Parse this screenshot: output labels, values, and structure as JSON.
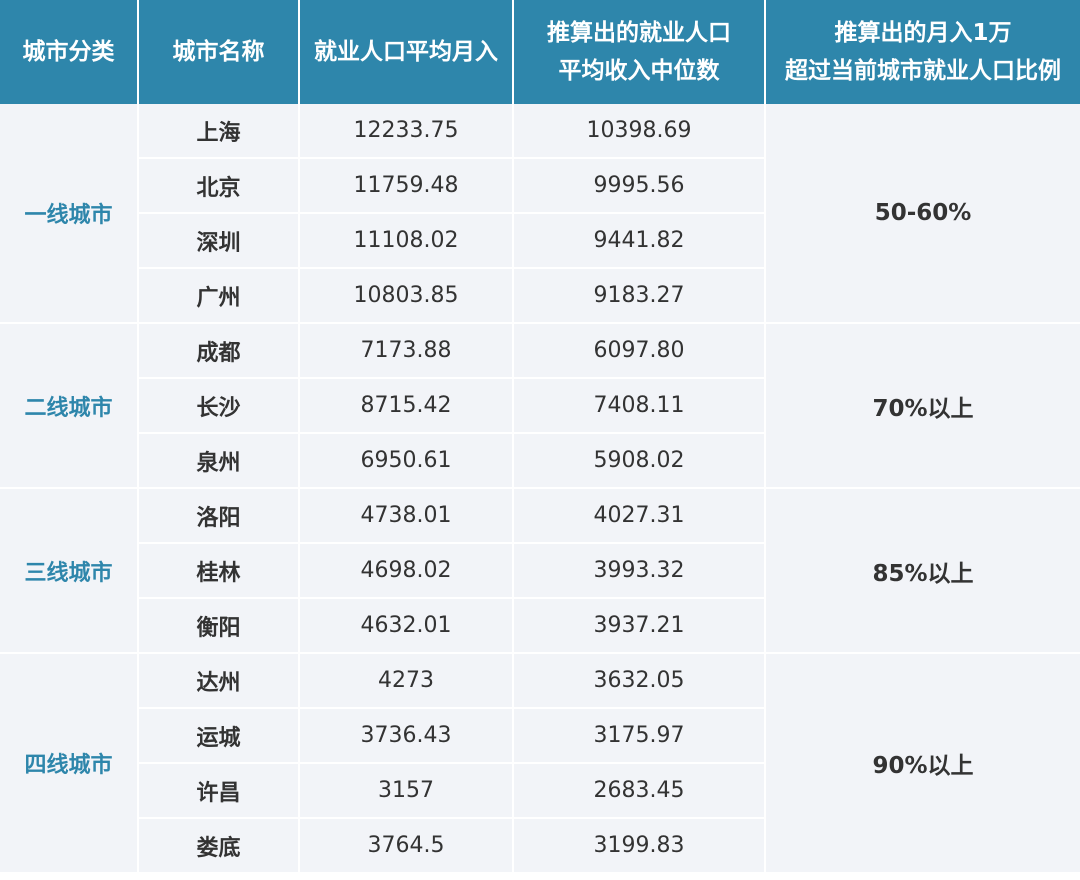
{
  "headers": {
    "category": "城市分类",
    "city": "城市名称",
    "avg_income": "就业人口平均月入",
    "median_income_line1": "推算出的就业人口",
    "median_income_line2": "平均收入中位数",
    "ratio_line1": "推算出的月入1万",
    "ratio_line2": "超过当前城市就业人口比例"
  },
  "groups": [
    {
      "category": "一线城市",
      "ratio": "50-60%",
      "rows": [
        {
          "city": "上海",
          "avg": "12233.75",
          "median": "10398.69"
        },
        {
          "city": "北京",
          "avg": "11759.48",
          "median": "9995.56"
        },
        {
          "city": "深圳",
          "avg": "11108.02",
          "median": "9441.82"
        },
        {
          "city": "广州",
          "avg": "10803.85",
          "median": "9183.27"
        }
      ]
    },
    {
      "category": "二线城市",
      "ratio": "70%以上",
      "rows": [
        {
          "city": "成都",
          "avg": "7173.88",
          "median": "6097.80"
        },
        {
          "city": "长沙",
          "avg": "8715.42",
          "median": "7408.11"
        },
        {
          "city": "泉州",
          "avg": "6950.61",
          "median": "5908.02"
        }
      ]
    },
    {
      "category": "三线城市",
      "ratio": "85%以上",
      "rows": [
        {
          "city": "洛阳",
          "avg": "4738.01",
          "median": "4027.31"
        },
        {
          "city": "桂林",
          "avg": "4698.02",
          "median": "3993.32"
        },
        {
          "city": "衡阳",
          "avg": "4632.01",
          "median": "3937.21"
        }
      ]
    },
    {
      "category": "四线城市",
      "ratio": "90%以上",
      "rows": [
        {
          "city": "达州",
          "avg": "4273",
          "median": "3632.05"
        },
        {
          "city": "运城",
          "avg": "3736.43",
          "median": "3175.97"
        },
        {
          "city": "许昌",
          "avg": "3157",
          "median": "2683.45"
        },
        {
          "city": "娄底",
          "avg": "3764.5",
          "median": "3199.83"
        }
      ]
    }
  ],
  "colors": {
    "header_bg": "#2e86ab",
    "header_text": "#ffffff",
    "cell_bg": "#f2f4f8",
    "category_text": "#2e86ab",
    "body_text": "#333333"
  }
}
